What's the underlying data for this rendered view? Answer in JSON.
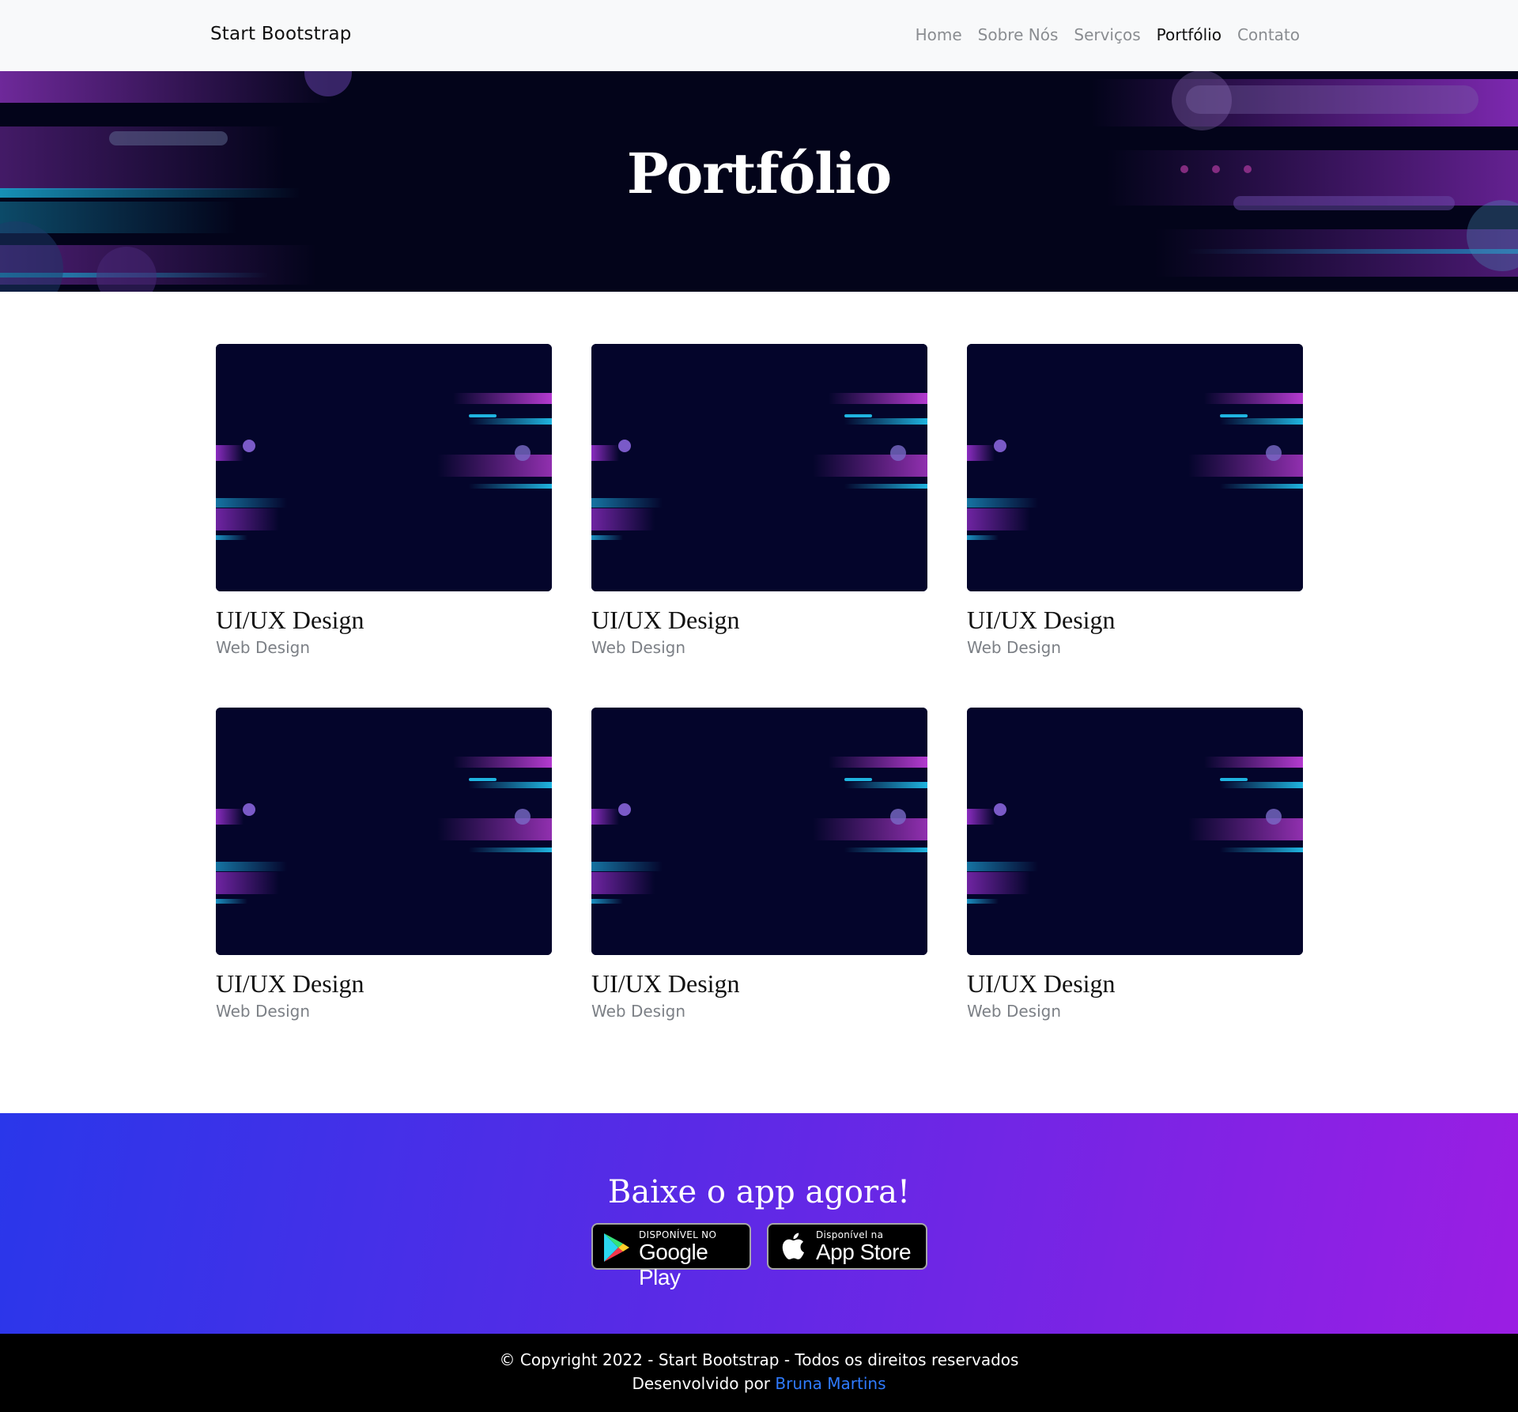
{
  "navbar": {
    "brand": "Start Bootstrap",
    "items": [
      {
        "label": "Home",
        "active": false
      },
      {
        "label": "Sobre Nós",
        "active": false
      },
      {
        "label": "Serviços",
        "active": false
      },
      {
        "label": "Portfólio",
        "active": true
      },
      {
        "label": "Contato",
        "active": false
      }
    ]
  },
  "hero": {
    "title": "Portfólio"
  },
  "portfolio": {
    "items": [
      {
        "title": "UI/UX Design",
        "category": "Web Design"
      },
      {
        "title": "UI/UX Design",
        "category": "Web Design"
      },
      {
        "title": "UI/UX Design",
        "category": "Web Design"
      },
      {
        "title": "UI/UX Design",
        "category": "Web Design"
      },
      {
        "title": "UI/UX Design",
        "category": "Web Design"
      },
      {
        "title": "UI/UX Design",
        "category": "Web Design"
      }
    ]
  },
  "app_section": {
    "title": "Baixe o app agora!",
    "google_play": {
      "small": "DISPONÍVEL NO",
      "big": "Google Play"
    },
    "app_store": {
      "small": "Disponível na",
      "big": "App Store"
    }
  },
  "footer": {
    "copyright": "© Copyright 2022 - Start Bootstrap - Todos os direitos reservados",
    "developed_by": "Desenvolvido por",
    "author": "Bruna Martins"
  },
  "colors": {
    "navbar_bg": "#f8f9fa",
    "hero_bg": "#03041a",
    "accent_purple": "#9b1ee3",
    "accent_blue": "#2a37ea",
    "link": "#2f7bff"
  }
}
